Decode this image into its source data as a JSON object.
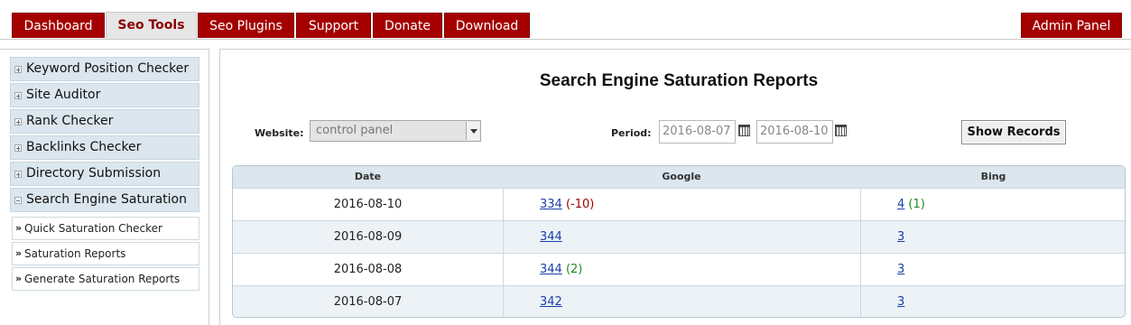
{
  "nav": {
    "tabs": [
      {
        "label": "Dashboard"
      },
      {
        "label": "Seo Tools"
      },
      {
        "label": "Seo Plugins"
      },
      {
        "label": "Support"
      },
      {
        "label": "Donate"
      },
      {
        "label": "Download"
      }
    ],
    "admin_label": "Admin Panel",
    "active_tab": "Seo Tools"
  },
  "sidebar": {
    "items": [
      {
        "label": "Keyword Position Checker",
        "state": "collapsed"
      },
      {
        "label": "Site Auditor",
        "state": "collapsed"
      },
      {
        "label": "Rank Checker",
        "state": "collapsed"
      },
      {
        "label": "Backlinks Checker",
        "state": "collapsed"
      },
      {
        "label": "Directory Submission",
        "state": "collapsed"
      },
      {
        "label": "Search Engine Saturation",
        "state": "expanded"
      }
    ],
    "subitems": [
      {
        "label": "Quick Saturation Checker"
      },
      {
        "label": "Saturation Reports"
      },
      {
        "label": "Generate Saturation Reports"
      }
    ]
  },
  "main": {
    "title": "Search Engine Saturation Reports",
    "website_label": "Website:",
    "website_value": "control panel",
    "period_label": "Period:",
    "period_from": "2016-08-07",
    "period_to": "2016-08-10",
    "show_button": "Show Records"
  },
  "table": {
    "headers": [
      "Date",
      "Google",
      "Bing"
    ],
    "rows": [
      {
        "date": "2016-08-10",
        "google": "334",
        "google_change": "(-10)",
        "bing": "4",
        "bing_change": "(1)"
      },
      {
        "date": "2016-08-09",
        "google": "344",
        "google_change": "",
        "bing": "3",
        "bing_change": ""
      },
      {
        "date": "2016-08-08",
        "google": "344",
        "google_change": "(2)",
        "bing": "3",
        "bing_change": ""
      },
      {
        "date": "2016-08-07",
        "google": "342",
        "google_change": "",
        "bing": "3",
        "bing_change": ""
      }
    ]
  },
  "colors": {
    "nav_tab": "#a50000",
    "nav_active_text": "#8b0000",
    "panel_header": "#dbe6ee",
    "link": "#1a3fa8",
    "negative": "#a00000",
    "positive": "#1f8a1f"
  },
  "icons": {
    "collapsed": "plus-icon",
    "expanded": "minus-icon",
    "subitem": "double-chevron-icon",
    "date_picker": "calendar-icon",
    "dropdown": "dropdown-arrow-icon"
  }
}
